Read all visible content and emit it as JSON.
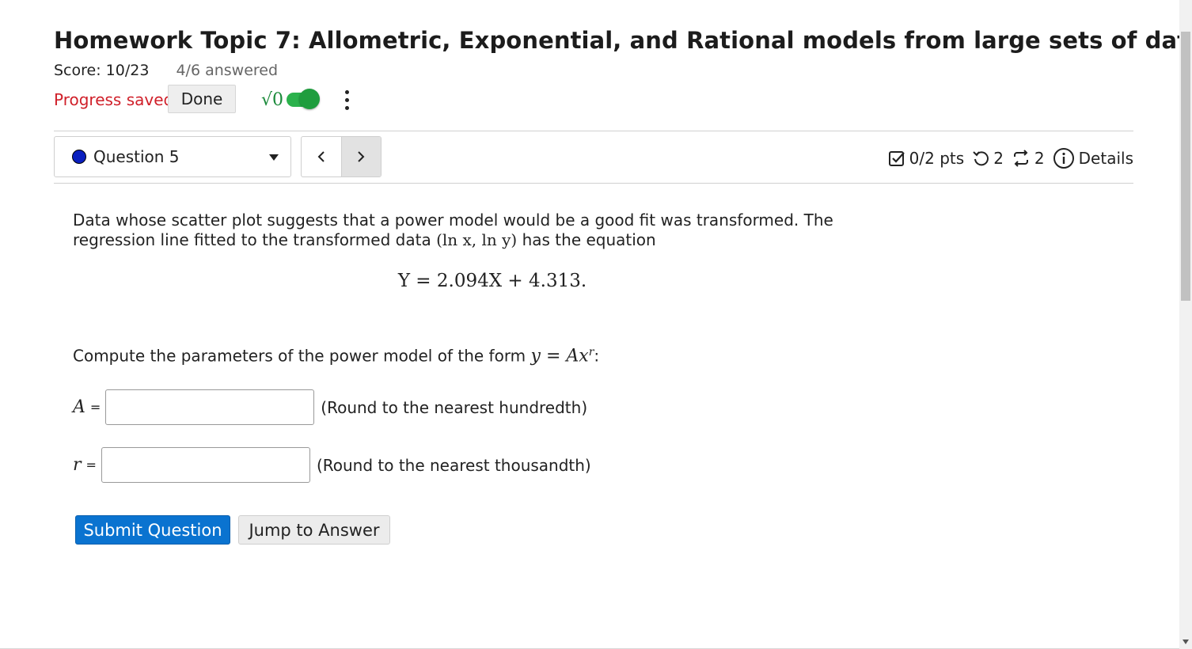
{
  "header": {
    "title": "Homework Topic 7: Allometric, Exponential, and Rational models from large sets of data",
    "score": "Score: 10/23",
    "answered": "4/6 answered",
    "progress_saved": "Progress saved",
    "done_label": "Done",
    "math_toggle_symbol": "√0",
    "math_toggle_on": true
  },
  "question_nav": {
    "selected": "Question 5",
    "status_color": "#0a1fbf"
  },
  "meta": {
    "points": "0/2 pts",
    "retries": "2",
    "similar": "2",
    "details": "Details"
  },
  "question": {
    "intro_1": "Data whose scatter plot suggests that a power model would be a good fit was transformed. The regression line fitted to the transformed data ",
    "intro_math": "(ln x, ln y)",
    "intro_2": " has the equation",
    "equation": "Y = 2.094X + 4.313.",
    "prompt_text": "Compute the parameters of the power model of the form ",
    "prompt_math": "y = Ax",
    "prompt_exp": "r",
    "prompt_end": ":",
    "fields": [
      {
        "var": "A",
        "eq": "=",
        "value": "",
        "hint": "(Round to the nearest hundredth)"
      },
      {
        "var": "r",
        "eq": "=",
        "value": "",
        "hint": "(Round to the nearest thousandth)"
      }
    ]
  },
  "actions": {
    "submit": "Submit Question",
    "jump": "Jump to Answer"
  },
  "colors": {
    "accent": "#0a73d0",
    "saved": "#d0202a",
    "toggle": "#2bb24c"
  }
}
